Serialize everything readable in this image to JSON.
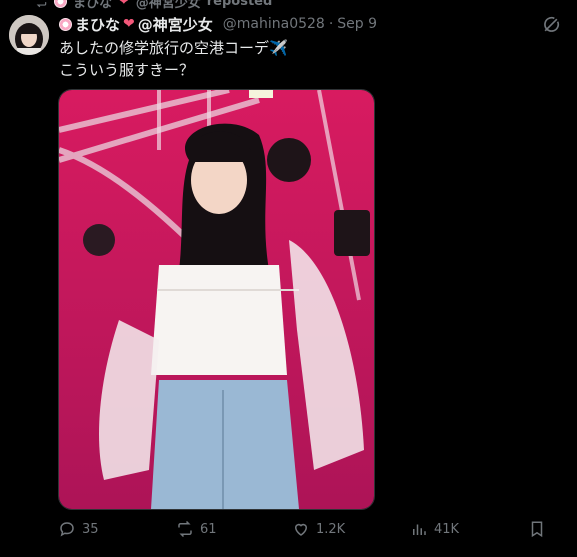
{
  "repost": {
    "user_name": "まひな",
    "user_suffix": "@神宮少女",
    "label": "reposted"
  },
  "tweet": {
    "display_name_main": "まひな",
    "display_name_suffix": "@神宮少女",
    "handle": "@mahina0528",
    "separator": "·",
    "date": "Sep 9",
    "text_lines": [
      "あしたの修学旅行の空港コーデ✈️",
      "こういう服すきー？"
    ]
  },
  "actions": {
    "replies": "35",
    "reposts": "61",
    "likes": "1.2K",
    "views": "41K"
  },
  "colors": {
    "background": "#000000",
    "text": "#e7e9ea",
    "muted": "#71767b",
    "heart": "#f4587a",
    "photo_backdrop": "#c2185b"
  },
  "icons": [
    "repost-icon",
    "flower-icon",
    "heart-emoji-icon",
    "grok-icon",
    "reply-icon",
    "like-icon",
    "views-icon",
    "bookmark-icon"
  ]
}
